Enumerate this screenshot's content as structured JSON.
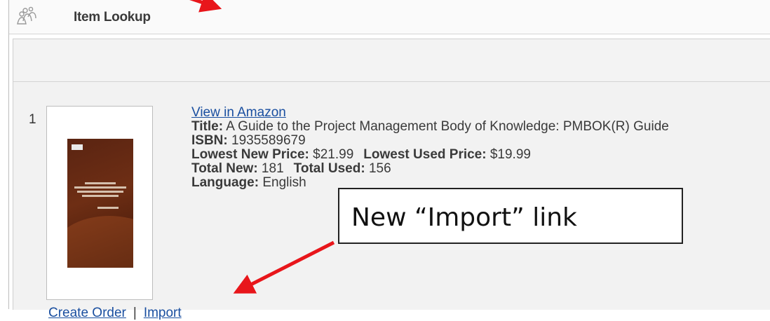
{
  "window": {
    "title": "Item Lookup",
    "title_icon": "people-group-icon"
  },
  "result": {
    "index": "1",
    "view_link": "View in Amazon",
    "title_label": "Title:",
    "title_value": " A Guide to the Project Management Body of Knowledge: PMBOK(R) Guide",
    "isbn_label": "ISBN:",
    "isbn_value": " 1935589679",
    "new_price_label": "Lowest New Price:",
    "new_price_value": " $21.99",
    "used_price_label": "Lowest Used Price:",
    "used_price_value": " $19.99",
    "total_new_label": "Total New:",
    "total_new_value": " 181",
    "total_used_label": "Total Used:",
    "total_used_value": " 156",
    "language_label": "Language:",
    "language_value": " English"
  },
  "actions": {
    "create_order": "Create Order",
    "separator": "|",
    "import": "Import"
  },
  "annotation": {
    "callout_text": "New “Import” link",
    "arrow_color": "#e8161b"
  }
}
